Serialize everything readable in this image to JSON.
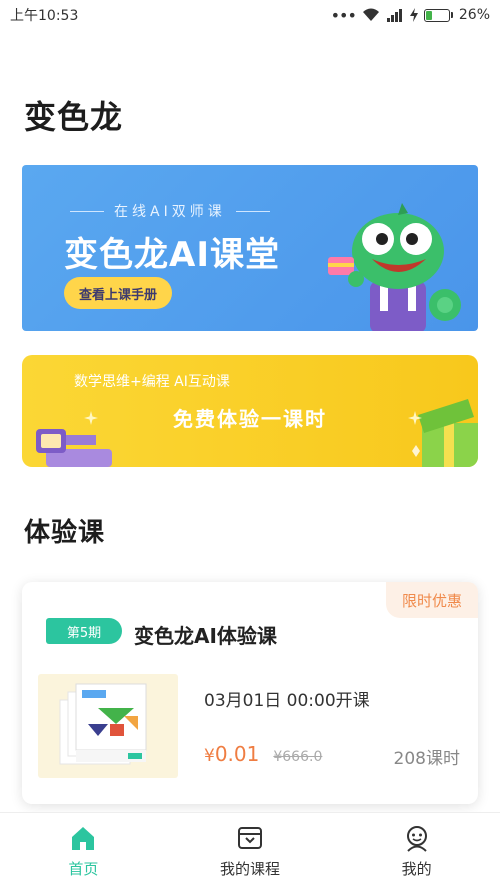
{
  "status_bar": {
    "time": "上午10:53",
    "battery": "26%",
    "battery_level": 0.26
  },
  "page": {
    "title": "变色龙"
  },
  "banner_main": {
    "subtitle": "在线AI双师课",
    "title": "变色龙AI课堂",
    "button": "查看上课手册"
  },
  "banner_promo": {
    "subtitle": "数学思维+编程 AI互动课",
    "title": "免费体验一课时"
  },
  "trial_section": {
    "title": "体验课"
  },
  "course": {
    "promo_tag": "限时优惠",
    "period": "第5期",
    "name": "变色龙AI体验课",
    "start_time": "03月01日 00:00开课",
    "currency": "¥",
    "price": "0.01",
    "original_price": "¥666.0",
    "lessons": "208课时"
  },
  "tab_bar": {
    "items": [
      {
        "label": "首页",
        "icon": "home-icon",
        "active": true
      },
      {
        "label": "我的课程",
        "icon": "course-box-icon",
        "active": false
      },
      {
        "label": "我的",
        "icon": "profile-icon",
        "active": false
      }
    ]
  },
  "colors": {
    "accent_green": "#2cc59f",
    "banner_blue": "#4a95ea",
    "banner_yellow": "#f8c81c",
    "price_orange": "#ef7d42"
  }
}
